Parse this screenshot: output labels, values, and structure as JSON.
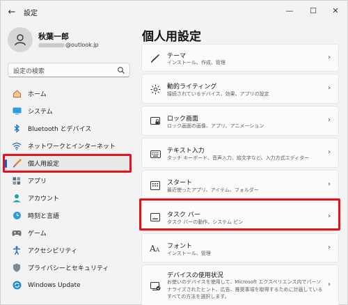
{
  "window": {
    "title": "設定",
    "back_glyph": "←",
    "minimize_glyph": "—",
    "maximize_glyph": "☐",
    "close_glyph": "✕"
  },
  "profile": {
    "name": "秋葉一郎",
    "email_suffix": "@outlook.jp"
  },
  "search": {
    "placeholder": "設定の検索"
  },
  "sidebar": {
    "items": [
      {
        "label": "ホーム",
        "icon": "home-icon",
        "color": "#e08a3c"
      },
      {
        "label": "システム",
        "icon": "system-icon",
        "color": "#1b8fd6"
      },
      {
        "label": "Bluetooth とデバイス",
        "icon": "bluetooth-icon",
        "color": "#1b8fd6"
      },
      {
        "label": "ネットワークとインターネット",
        "icon": "network-icon",
        "color": "#2a6db5"
      },
      {
        "label": "個人用設定",
        "icon": "personalization-icon",
        "color": "#d98c2b",
        "active": true
      },
      {
        "label": "アプリ",
        "icon": "apps-icon",
        "color": "#5b6b7a"
      },
      {
        "label": "アカウント",
        "icon": "accounts-icon",
        "color": "#1fa2a0"
      },
      {
        "label": "時刻と言語",
        "icon": "time-language-icon",
        "color": "#1b8fd6"
      },
      {
        "label": "ゲーム",
        "icon": "gaming-icon",
        "color": "#6e6e6e"
      },
      {
        "label": "アクセシビリティ",
        "icon": "accessibility-icon",
        "color": "#1b6fc4"
      },
      {
        "label": "プライバシーとセキュリティ",
        "icon": "privacy-icon",
        "color": "#6e7b86"
      },
      {
        "label": "Windows Update",
        "icon": "windows-update-icon",
        "color": "#1b8fd6"
      }
    ]
  },
  "main": {
    "title": "個人用設定",
    "cards": [
      {
        "title": "テーマ",
        "subtitle": "インストール、作成、管理",
        "icon": "theme-brush-icon"
      },
      {
        "title": "動的ライティング",
        "subtitle": "接続されているデバイス、効果、アプリの設定",
        "icon": "dynamic-lighting-icon"
      },
      {
        "title": "ロック画面",
        "subtitle": "ロック画面の画像、アプリ、アニメーション",
        "icon": "lock-screen-icon"
      },
      {
        "title": "テキスト入力",
        "subtitle": "タッチ キーボード、音声入力、絵文字など、入力方式エディター",
        "icon": "keyboard-icon"
      },
      {
        "title": "スタート",
        "subtitle": "最近使ったアプリ、アイテム、フォルダー",
        "icon": "start-icon"
      },
      {
        "title": "タスク バー",
        "subtitle": "タスク バーの動作、システム ピン",
        "icon": "taskbar-icon"
      },
      {
        "title": "フォント",
        "subtitle": "インストール、管理",
        "icon": "fonts-icon"
      },
      {
        "title": "デバイスの使用状況",
        "subtitle": "お使いのデバイスを使用して、Microsoft エクスペリエンス内でパーソナライズされたヒント、広告、推奨事項を取得するために計画しているすべての方法を選択します。",
        "icon": "device-usage-icon"
      }
    ],
    "chevron_glyph": "›"
  },
  "highlight_color": "#e5121d",
  "accent_color": "#0067c0"
}
